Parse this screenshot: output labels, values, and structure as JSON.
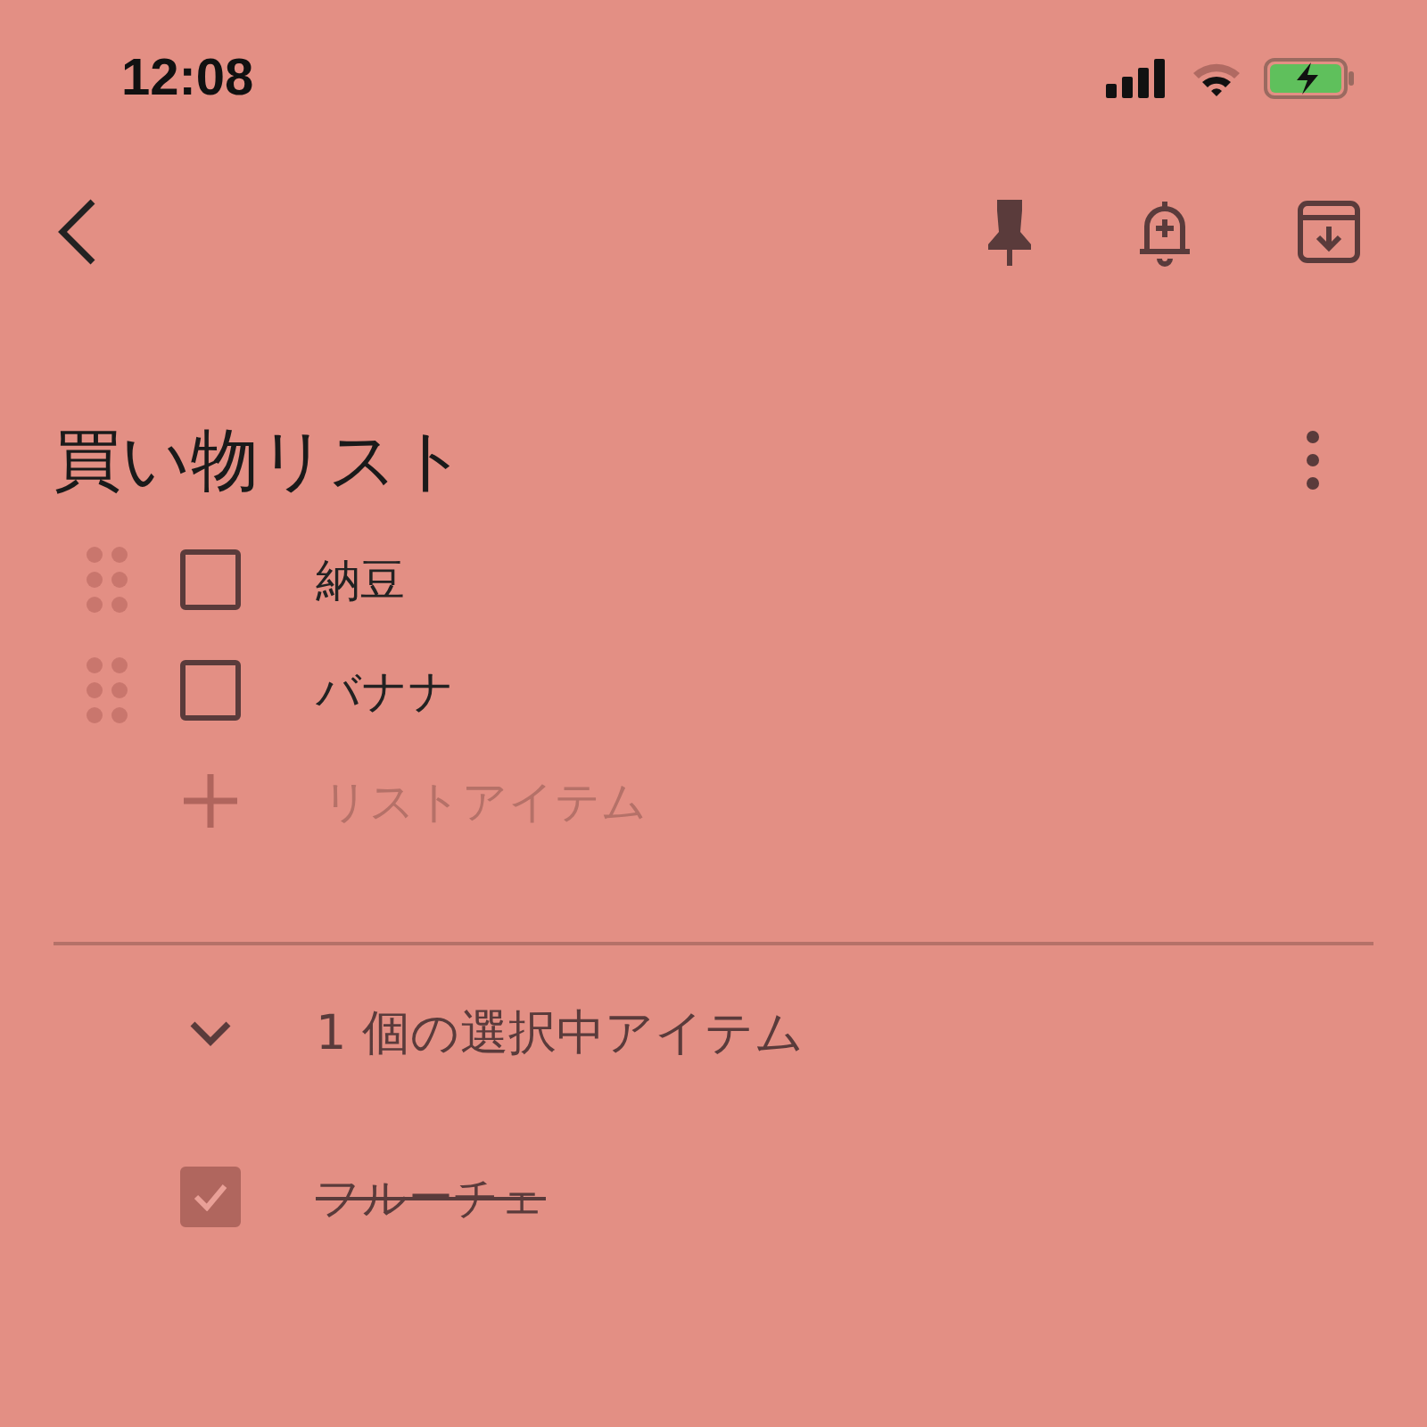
{
  "status_bar": {
    "time": "12:08"
  },
  "note": {
    "title": "買い物リスト",
    "items": [
      {
        "text": "納豆",
        "checked": false
      },
      {
        "text": "バナナ",
        "checked": false
      }
    ],
    "add_placeholder": "リストアイテム",
    "checked_section": {
      "label": "1 個の選択中アイテム",
      "expanded": true,
      "items": [
        {
          "text": "フルーチェ",
          "checked": true
        }
      ]
    }
  }
}
